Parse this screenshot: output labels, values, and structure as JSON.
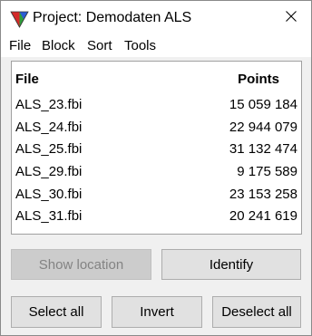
{
  "window": {
    "title": "Project: Demodaten ALS"
  },
  "menu": {
    "items": [
      {
        "label": "File"
      },
      {
        "label": "Block"
      },
      {
        "label": "Sort"
      },
      {
        "label": "Tools"
      }
    ]
  },
  "list": {
    "headers": {
      "file": "File",
      "points": "Points"
    },
    "rows": [
      {
        "file": "ALS_23.fbi",
        "points": "15 059 184"
      },
      {
        "file": "ALS_24.fbi",
        "points": "22 944 079"
      },
      {
        "file": "ALS_25.fbi",
        "points": "31 132 474"
      },
      {
        "file": "ALS_29.fbi",
        "points": "9 175 589"
      },
      {
        "file": "ALS_30.fbi",
        "points": "23 153 258"
      },
      {
        "file": "ALS_31.fbi",
        "points": "20 241 619"
      }
    ]
  },
  "buttons": {
    "show_location": {
      "label": "Show location",
      "enabled": false
    },
    "identify": {
      "label": "Identify",
      "enabled": true
    },
    "select_all": {
      "label": "Select all",
      "enabled": true
    },
    "invert": {
      "label": "Invert",
      "enabled": true
    },
    "deselect_all": {
      "label": "Deselect all",
      "enabled": true
    }
  },
  "icons": {
    "app": "app-logo-icon",
    "close": "close-icon"
  }
}
